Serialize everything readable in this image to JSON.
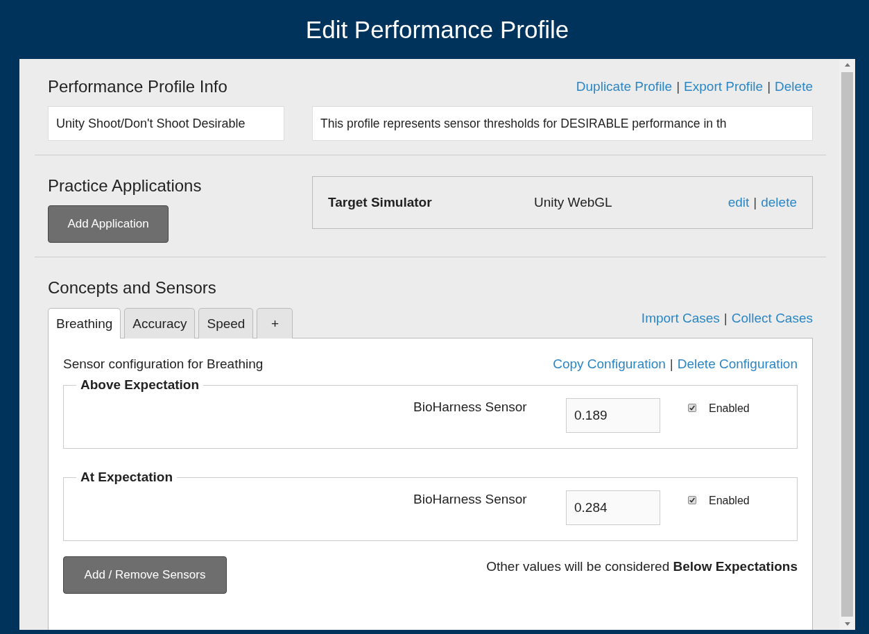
{
  "window": {
    "title": "Edit Performance Profile"
  },
  "profile_info": {
    "heading": "Performance Profile Info",
    "separator": "|",
    "links": [
      "Duplicate Profile",
      "Export Profile",
      "Delete"
    ],
    "name_value": "Unity Shoot/Don't Shoot Desirable",
    "description_value": "This profile represents sensor thresholds for DESIRABLE performance in th"
  },
  "practice_applications": {
    "heading": "Practice Applications",
    "add_button": "Add Application",
    "separator": "|",
    "apps": [
      {
        "name": "Target Simulator",
        "platform": "Unity WebGL",
        "links": [
          "edit",
          "delete"
        ]
      }
    ]
  },
  "concepts": {
    "heading": "Concepts and Sensors",
    "separator": "|",
    "links": [
      "Import Cases",
      "Collect Cases"
    ],
    "tabs": [
      {
        "label": "Breathing",
        "selected": true
      },
      {
        "label": "Accuracy",
        "selected": false
      },
      {
        "label": "Speed",
        "selected": false
      },
      {
        "label": "+",
        "selected": false
      }
    ],
    "config": {
      "caption": "Sensor configuration for Breathing",
      "links": [
        "Copy Configuration",
        "Delete Configuration"
      ],
      "groups": [
        {
          "legend": "Above Expectation",
          "sensors": [
            {
              "name": "BioHarness Sensor",
              "value": "0.189",
              "enabled": true,
              "enabled_label": "Enabled"
            }
          ]
        },
        {
          "legend": "At Expectation",
          "sensors": [
            {
              "name": "BioHarness Sensor",
              "value": "0.284",
              "enabled": true,
              "enabled_label": "Enabled"
            }
          ]
        }
      ],
      "add_button": "Add / Remove Sensors",
      "note": "Other values will be considered **Below Expectations**"
    }
  }
}
